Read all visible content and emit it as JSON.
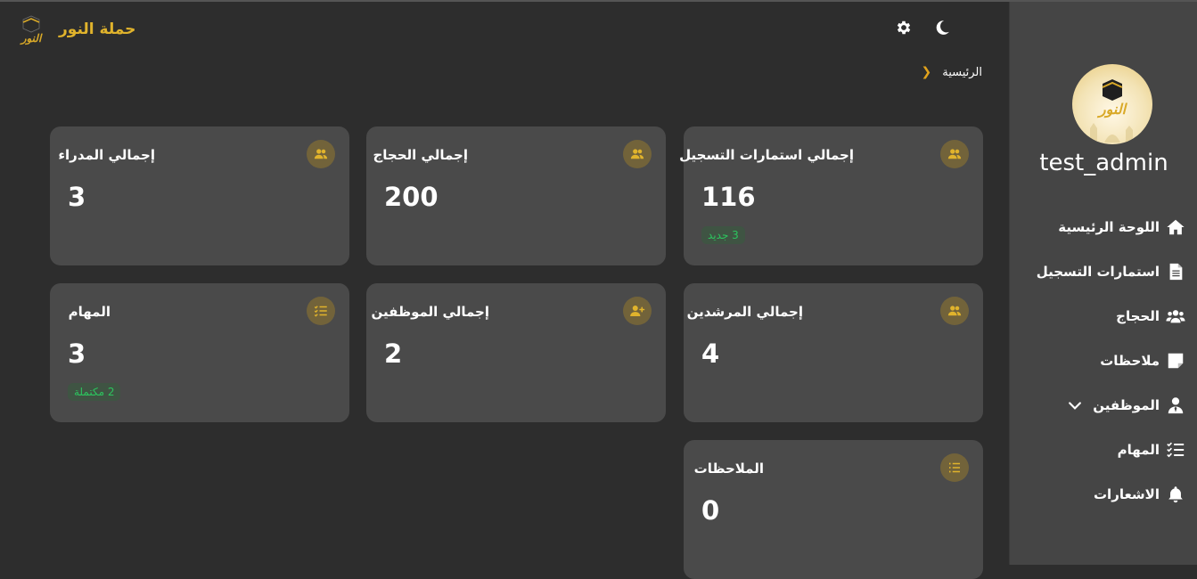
{
  "header": {
    "brand_name": "حملة النور",
    "logo_text": "النور",
    "settings_icon": "gear-icon",
    "theme_icon": "moon-icon"
  },
  "breadcrumb": {
    "current": "الرئيسية"
  },
  "cards": {
    "total_forms": {
      "title": "إجمالي استمارات التسجيل",
      "value": "116",
      "badge": "3 جديد",
      "icon": "users-icon"
    },
    "total_pilgrims": {
      "title": "إجمالي الحجاج",
      "value": "200",
      "icon": "users-icon"
    },
    "total_managers": {
      "title": "إجمالي المدراء",
      "value": "3",
      "icon": "users-icon"
    },
    "total_guides": {
      "title": "إجمالي المرشدين",
      "value": "4",
      "icon": "users-icon"
    },
    "total_employees": {
      "title": "إجمالي الموظفين",
      "value": "2",
      "icon": "user-plus-icon"
    },
    "tasks": {
      "title": "المهام",
      "value": "3",
      "badge": "2 مكتملة",
      "icon": "tasks-icon"
    },
    "notes": {
      "title": "الملاحظات",
      "value": "0",
      "icon": "list-icon"
    }
  },
  "sidebar": {
    "username": "test_admin",
    "items": [
      {
        "label": "اللوحة الرئيسية",
        "icon": "home-icon"
      },
      {
        "label": "استمارات التسجيل",
        "icon": "document-icon"
      },
      {
        "label": "الحجاج",
        "icon": "users-icon"
      },
      {
        "label": "ملاحظات",
        "icon": "sticky-note-icon"
      },
      {
        "label": "الموظفين",
        "icon": "user-tie-icon"
      },
      {
        "label": "المهام",
        "icon": "tasks-icon"
      },
      {
        "label": "الاشعارات",
        "icon": "bell-icon"
      }
    ]
  },
  "colors": {
    "accent": "#e0b32c",
    "background": "#2d2d2d",
    "card": "#4a4a4a",
    "sidebar": "#454545",
    "success": "#2cc55e"
  }
}
